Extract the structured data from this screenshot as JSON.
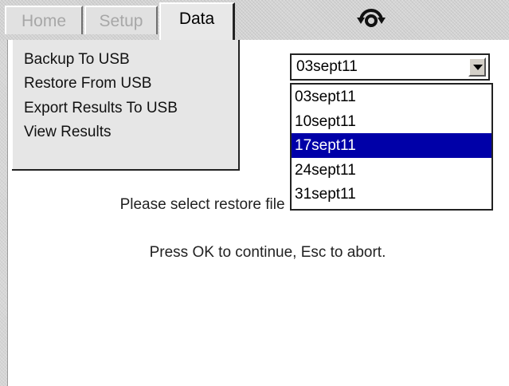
{
  "tabs": [
    {
      "label": "Home",
      "state": "inactive"
    },
    {
      "label": "Setup",
      "state": "inactive"
    },
    {
      "label": "Data",
      "state": "active"
    }
  ],
  "status_icon": "usb-connection-icon",
  "data_menu": {
    "items": [
      {
        "label": "Backup To USB"
      },
      {
        "label": "Restore From USB"
      },
      {
        "label": "Export Results To USB"
      },
      {
        "label": "View Results"
      }
    ]
  },
  "file_select": {
    "value": "03sept11",
    "arrow_icon": "chevron-down-icon",
    "options": [
      "03sept11",
      "10sept11",
      "17sept11",
      "24sept11",
      "31sept11"
    ],
    "highlighted": "17sept11"
  },
  "messages": {
    "select": "Please select restore file name from list.",
    "press": "Press OK to continue, Esc to abort."
  },
  "colors": {
    "highlight": "#0000a8",
    "background": "#ffffff",
    "panel": "#d7d7d7"
  }
}
